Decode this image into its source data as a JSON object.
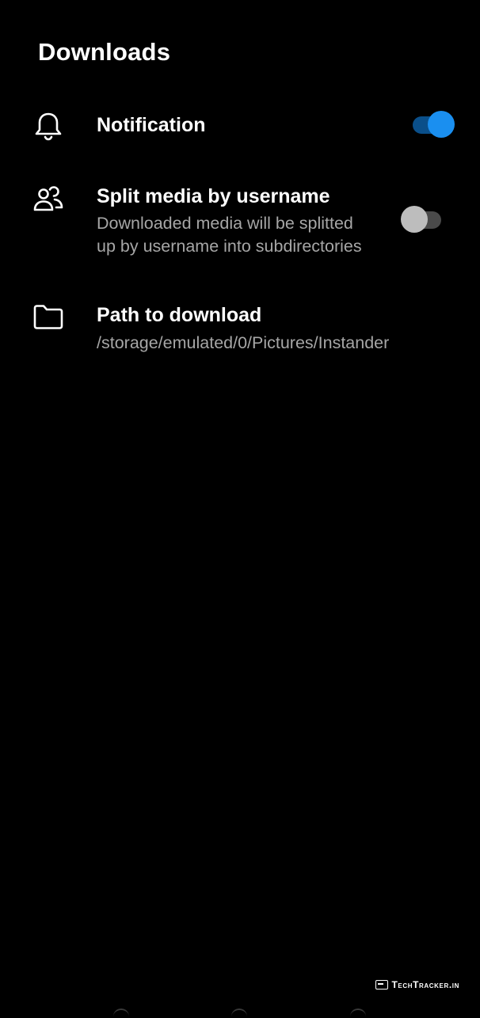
{
  "page": {
    "title": "Downloads"
  },
  "settings": {
    "notification": {
      "icon": "bell-icon",
      "title": "Notification",
      "enabled": true
    },
    "split_media": {
      "icon": "users-icon",
      "title": "Split media by username",
      "subtitle_line1": "Downloaded media will be splitted",
      "subtitle_line2": "up by username into subdirectories",
      "enabled": false
    },
    "download_path": {
      "icon": "folder-icon",
      "title": "Path to download",
      "value": "/storage/emulated/0/Pictures/Instander"
    }
  },
  "watermark": {
    "text": "TechTracker.in"
  },
  "colors": {
    "background": "#000000",
    "text_primary": "#ffffff",
    "text_secondary": "#a6a6a6",
    "accent": "#1a8ff0",
    "accent_track": "#0a4f8a",
    "toggle_off_thumb": "#bdbdbd",
    "toggle_off_track": "#4a4a4a"
  }
}
